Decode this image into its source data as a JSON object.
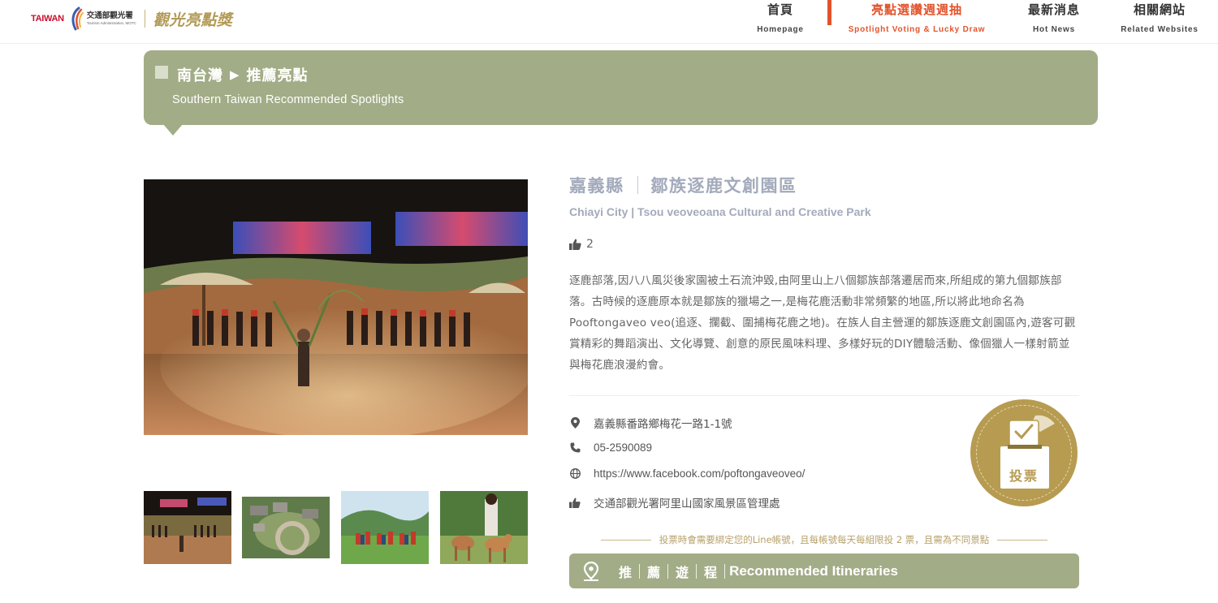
{
  "header": {
    "logo_taiwan": "TAIWAN",
    "logo_agency_zh": "交通部觀光署",
    "logo_agency_en": "Tourism Administration, MOTC",
    "logo_campaign": "觀光亮點獎",
    "nav": [
      {
        "zh": "首頁",
        "en": "Homepage",
        "active": false
      },
      {
        "zh": "亮點選讚週週抽",
        "en": "Spotlight Voting & Lucky Draw",
        "active": true
      },
      {
        "zh": "最新消息",
        "en": "Hot News",
        "active": false
      },
      {
        "zh": "相關網站",
        "en": "Related Websites",
        "active": false
      }
    ],
    "accent_color": "#e2532b"
  },
  "banner": {
    "region": "南台灣",
    "section": "推薦亮點",
    "subtitle": "Southern Taiwan Recommended Spotlights",
    "color": "#a2ac87"
  },
  "spot": {
    "county": "嘉義縣",
    "name": "鄒族逐鹿文創園區",
    "title_en": "Chiayi City | Tsou veoveoana Cultural and Creative Park",
    "likes": "2",
    "description": "逐鹿部落,因八八風災後家園被土石流沖毀,由阿里山上八個鄒族部落遷居而來,所組成的第九個鄒族部落。古時候的逐鹿原本就是鄒族的獵場之一,是梅花鹿活動非常頻繁的地區,所以將此地命名為Pooftongaveo veo(追逐、攔截、圍捕梅花鹿之地)。在族人自主營運的鄒族逐鹿文創園區內,遊客可觀賞精彩的舞蹈演出、文化導覽、創意的原民風味料理、多樣好玩的DIY體驗活動、像個獵人一樣射箭並與梅花鹿浪漫約會。",
    "address": "嘉義縣番路鄉梅花一路1-1號",
    "phone": "05-2590089",
    "website": "https://www.facebook.com/poftongaveoveo/",
    "recommender": "交通部觀光署阿里山國家風景區管理處",
    "photo_icons": [
      "stage-performance-photo",
      "aerial-park-photo",
      "group-photo",
      "deer-photo"
    ]
  },
  "vote": {
    "label": "投票",
    "color": "#b69b51",
    "notice": "投票時會需要綁定您的Line帳號，且每帳號每天每組限投 2 票，且需為不同景點"
  },
  "itinerary": {
    "chars": [
      "推",
      "薦",
      "遊",
      "程"
    ],
    "label_en": "Recommended Itineraries"
  }
}
